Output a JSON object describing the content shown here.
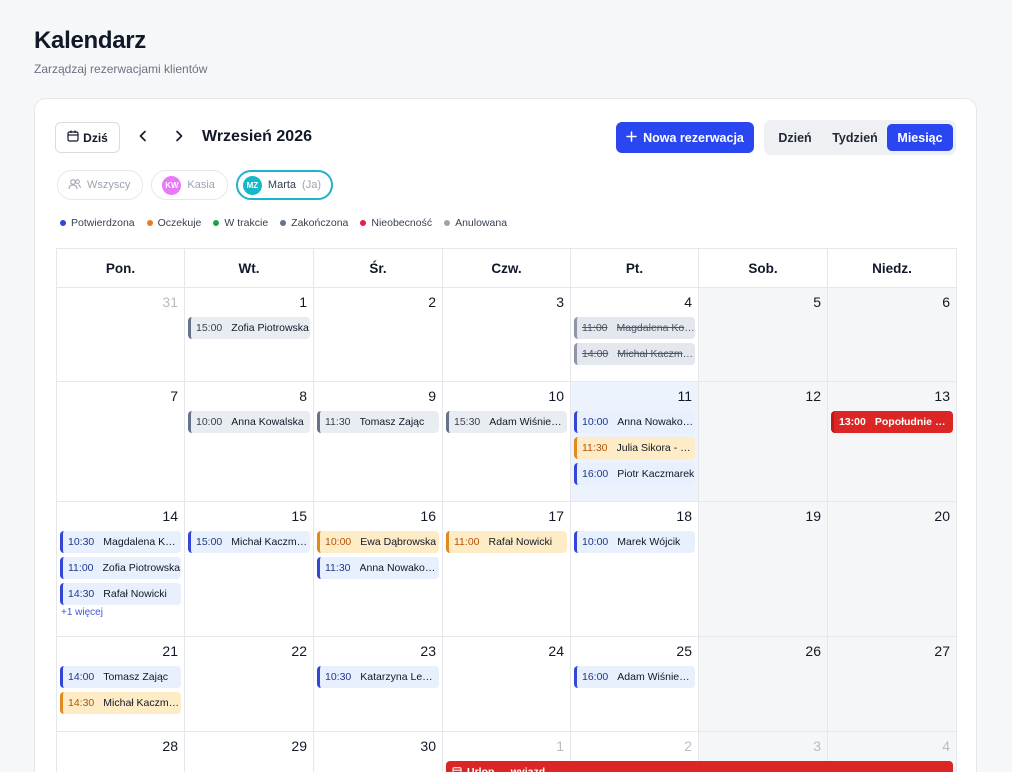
{
  "page": {
    "title": "Kalendarz",
    "subtitle": "Zarządzaj rezerwacjami klientów"
  },
  "toolbar": {
    "today_label": "Dziś",
    "month_label": "Wrzesień 2026",
    "new_booking_label": "Nowa rezerwacja",
    "views": [
      {
        "label": "Dzień",
        "active": false
      },
      {
        "label": "Tydzień",
        "active": false
      },
      {
        "label": "Miesiąc",
        "active": true
      }
    ]
  },
  "people": [
    {
      "label": "Wszyscy",
      "initials": "",
      "color": "",
      "suffix": "",
      "active": false
    },
    {
      "label": "Kasia",
      "initials": "KW",
      "color": "#e879f9",
      "suffix": "",
      "active": false
    },
    {
      "label": "Marta",
      "initials": "MZ",
      "color": "#14b8c8",
      "suffix": "(Ja)",
      "active": true
    }
  ],
  "legend": [
    {
      "label": "Potwierdzona",
      "color": "#2f45d8"
    },
    {
      "label": "Oczekuje",
      "color": "#e67e22"
    },
    {
      "label": "W trakcie",
      "color": "#16a34a"
    },
    {
      "label": "Zakończona",
      "color": "#64748b"
    },
    {
      "label": "Nieobecność",
      "color": "#e11d48"
    },
    {
      "label": "Anulowana",
      "color": "#9ca3af"
    }
  ],
  "weekdays": [
    "Pon.",
    "Wt.",
    "Śr.",
    "Czw.",
    "Pt.",
    "Sob.",
    "Niedz."
  ],
  "weeks": [
    [
      {
        "day": "31",
        "out": true,
        "weekend": false,
        "today": false,
        "events": []
      },
      {
        "day": "1",
        "out": false,
        "weekend": false,
        "today": false,
        "events": [
          {
            "time": "15:00",
            "name": "Zofia Piotrowska",
            "status": "completed"
          }
        ]
      },
      {
        "day": "2",
        "out": false,
        "weekend": false,
        "today": false,
        "events": []
      },
      {
        "day": "3",
        "out": false,
        "weekend": false,
        "today": false,
        "events": []
      },
      {
        "day": "4",
        "out": false,
        "weekend": false,
        "today": false,
        "events": [
          {
            "time": "11:00",
            "name": "Magdalena Kowalczyk",
            "status": "cancelled"
          },
          {
            "time": "14:00",
            "name": "Michał Kaczmarek",
            "status": "cancelled"
          }
        ]
      },
      {
        "day": "5",
        "out": false,
        "weekend": true,
        "today": false,
        "events": []
      },
      {
        "day": "6",
        "out": false,
        "weekend": true,
        "today": false,
        "events": []
      }
    ],
    [
      {
        "day": "7",
        "out": false,
        "weekend": false,
        "today": false,
        "events": []
      },
      {
        "day": "8",
        "out": false,
        "weekend": false,
        "today": false,
        "events": [
          {
            "time": "10:00",
            "name": "Anna Kowalska",
            "status": "completed"
          }
        ]
      },
      {
        "day": "9",
        "out": false,
        "weekend": false,
        "today": false,
        "events": [
          {
            "time": "11:30",
            "name": "Tomasz Zając",
            "status": "completed"
          }
        ]
      },
      {
        "day": "10",
        "out": false,
        "weekend": false,
        "today": false,
        "events": [
          {
            "time": "15:30",
            "name": "Adam Wiśniewski",
            "status": "completed"
          }
        ]
      },
      {
        "day": "11",
        "out": false,
        "weekend": false,
        "today": true,
        "events": [
          {
            "time": "10:00",
            "name": "Anna Nowakowska",
            "status": "confirmed"
          },
          {
            "time": "11:30",
            "name": "Julia Sikora - konsultacja",
            "status": "pending"
          },
          {
            "time": "16:00",
            "name": "Piotr Kaczmarek",
            "status": "confirmed"
          }
        ]
      },
      {
        "day": "12",
        "out": false,
        "weekend": true,
        "today": false,
        "events": []
      },
      {
        "day": "13",
        "out": false,
        "weekend": true,
        "today": false,
        "events": [
          {
            "time": "13:00",
            "name": "Popołudnie wolne",
            "status": "block"
          }
        ]
      }
    ],
    [
      {
        "day": "14",
        "out": false,
        "weekend": false,
        "today": false,
        "events": [
          {
            "time": "10:30",
            "name": "Magdalena Kowalczyk",
            "status": "confirmed"
          },
          {
            "time": "11:00",
            "name": "Zofia Piotrowska",
            "status": "confirmed"
          },
          {
            "time": "14:30",
            "name": "Rafał Nowicki",
            "status": "confirmed"
          }
        ],
        "more": "+1 więcej"
      },
      {
        "day": "15",
        "out": false,
        "weekend": false,
        "today": false,
        "events": [
          {
            "time": "15:00",
            "name": "Michał Kaczmarek",
            "status": "confirmed"
          }
        ]
      },
      {
        "day": "16",
        "out": false,
        "weekend": false,
        "today": false,
        "events": [
          {
            "time": "10:00",
            "name": "Ewa Dąbrowska",
            "status": "pending"
          },
          {
            "time": "11:30",
            "name": "Anna Nowakowska",
            "status": "confirmed"
          }
        ]
      },
      {
        "day": "17",
        "out": false,
        "weekend": false,
        "today": false,
        "events": [
          {
            "time": "11:00",
            "name": "Rafał Nowicki",
            "status": "pending"
          }
        ]
      },
      {
        "day": "18",
        "out": false,
        "weekend": false,
        "today": false,
        "events": [
          {
            "time": "10:00",
            "name": "Marek Wójcik",
            "status": "confirmed"
          }
        ]
      },
      {
        "day": "19",
        "out": false,
        "weekend": true,
        "today": false,
        "events": []
      },
      {
        "day": "20",
        "out": false,
        "weekend": true,
        "today": false,
        "events": []
      }
    ],
    [
      {
        "day": "21",
        "out": false,
        "weekend": false,
        "today": false,
        "events": [
          {
            "time": "14:00",
            "name": "Tomasz Zając",
            "status": "confirmed"
          },
          {
            "time": "14:30",
            "name": "Michał Kaczmarek",
            "status": "pending"
          }
        ]
      },
      {
        "day": "22",
        "out": false,
        "weekend": false,
        "today": false,
        "events": []
      },
      {
        "day": "23",
        "out": false,
        "weekend": false,
        "today": false,
        "events": [
          {
            "time": "10:30",
            "name": "Katarzyna Lewandowska",
            "status": "confirmed"
          }
        ]
      },
      {
        "day": "24",
        "out": false,
        "weekend": false,
        "today": false,
        "events": []
      },
      {
        "day": "25",
        "out": false,
        "weekend": false,
        "today": false,
        "events": [
          {
            "time": "16:00",
            "name": "Adam Wiśniewski",
            "status": "confirmed"
          }
        ]
      },
      {
        "day": "26",
        "out": false,
        "weekend": true,
        "today": false,
        "events": []
      },
      {
        "day": "27",
        "out": false,
        "weekend": true,
        "today": false,
        "events": []
      }
    ],
    [
      {
        "day": "28",
        "out": false,
        "weekend": false,
        "today": false,
        "events": []
      },
      {
        "day": "29",
        "out": false,
        "weekend": false,
        "today": false,
        "events": []
      },
      {
        "day": "30",
        "out": false,
        "weekend": false,
        "today": false,
        "events": []
      },
      {
        "day": "1",
        "out": true,
        "weekend": false,
        "today": false,
        "events": []
      },
      {
        "day": "2",
        "out": true,
        "weekend": false,
        "today": false,
        "events": []
      },
      {
        "day": "3",
        "out": true,
        "weekend": true,
        "today": false,
        "events": []
      },
      {
        "day": "4",
        "out": true,
        "weekend": true,
        "today": false,
        "events": []
      }
    ]
  ],
  "span_event": {
    "label": "Urlop — wyjazd",
    "icon": "calendar-icon"
  }
}
